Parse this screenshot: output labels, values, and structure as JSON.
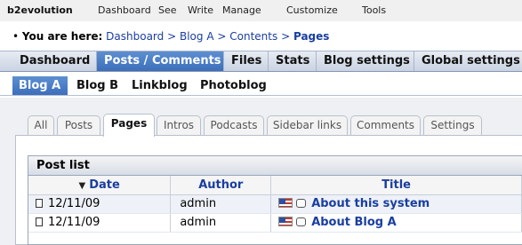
{
  "topbar": {
    "brand": "b2evolution",
    "items": [
      "Dashboard",
      "See",
      "Write",
      "Manage",
      "Customize",
      "Tools"
    ]
  },
  "breadcrumb": {
    "label": "You are here:",
    "crumbs": [
      "Dashboard",
      "Blog A",
      "Contents"
    ],
    "current": "Pages",
    "separator": ">"
  },
  "mainmenu": {
    "items": [
      "Dashboard",
      "Posts / Comments",
      "Files",
      "Stats",
      "Blog settings",
      "Global settings"
    ],
    "active": "Posts / Comments"
  },
  "submenu": {
    "items": [
      "Blog A",
      "Blog B",
      "Linkblog",
      "Photoblog"
    ],
    "active": "Blog A"
  },
  "tabs": {
    "items": [
      "All",
      "Posts",
      "Pages",
      "Intros",
      "Podcasts",
      "Sidebar links",
      "Comments",
      "Settings"
    ],
    "active": "Pages"
  },
  "postlist": {
    "title": "Post list",
    "columns": [
      "Date",
      "Author",
      "Title"
    ],
    "rows": [
      {
        "date": "12/11/09",
        "author": "admin",
        "title": "About this system"
      },
      {
        "date": "12/11/09",
        "author": "admin",
        "title": "About Blog A"
      }
    ]
  },
  "colors": {
    "accent": "#4a7cc4",
    "link": "#1a3ea0"
  },
  "icons": [
    "sort-desc-icon",
    "page-icon",
    "flag-us-icon",
    "comment-icon"
  ]
}
